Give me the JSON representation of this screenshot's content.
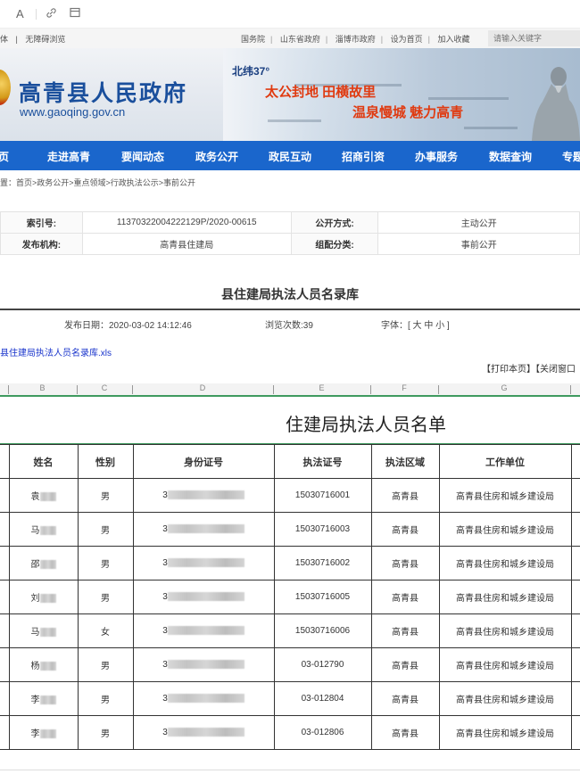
{
  "browser_toolbar": {
    "icons": [
      "font-icon",
      "link-icon",
      "window-icon"
    ],
    "font_glyph": "A"
  },
  "topbar": {
    "left_links": [
      "体",
      "|",
      "无障碍浏览"
    ],
    "right_links": [
      "国务院",
      "山东省政府",
      "淄博市政府",
      "设为首页",
      "加入收藏"
    ],
    "separator": "|",
    "search_placeholder": "请输入关键字"
  },
  "banner": {
    "site_name": "高青县人民政府",
    "site_url": "www.gaoqing.gov.cn",
    "latitude": "北纬37°",
    "slogan_line1": "太公封地  田横故里",
    "slogan_line2": "温泉慢城 魅力高青"
  },
  "nav": {
    "items": [
      "页",
      "走进高青",
      "要闻动态",
      "政务公开",
      "政民互动",
      "招商引资",
      "办事服务",
      "数据查询",
      "专题"
    ]
  },
  "breadcrumb": "置：首页>政务公开>重点领域>行政执法公示>事前公开",
  "meta": {
    "index_label": "索引号:",
    "index_value": "11370322004222129P/2020-00615",
    "disclosure_label": "公开方式:",
    "disclosure_value": "主动公开",
    "publisher_label": "发布机构:",
    "publisher_value": "高青县住建局",
    "category_label": "组配分类:",
    "category_value": "事前公开"
  },
  "article": {
    "title": "县住建局执法人员名录库",
    "publish_date": "发布日期：2020-03-02 14:12:46",
    "views": "浏览次数:39",
    "font_size": "字体：[ 大 中 小 ]",
    "attachment": "县住建局执法人员名录库.xls",
    "print": "【打印本页】",
    "close": "【关闭窗口"
  },
  "sheet": {
    "column_letters": [
      "B",
      "C",
      "D",
      "E",
      "F",
      "G"
    ],
    "title": "住建局执法人员名单",
    "headers": [
      "姓名",
      "性别",
      "身份证号",
      "执法证号",
      "执法区域",
      "工作单位"
    ],
    "rows": [
      {
        "name": "袁",
        "gender": "男",
        "id": "3",
        "cert": "15030716001",
        "area": "高青县",
        "unit": "高青县住房和城乡建设局"
      },
      {
        "name": "马",
        "gender": "男",
        "id": "3",
        "cert": "15030716003",
        "area": "高青县",
        "unit": "高青县住房和城乡建设局"
      },
      {
        "name": "邵",
        "gender": "男",
        "id": "3",
        "cert": "15030716002",
        "area": "高青县",
        "unit": "高青县住房和城乡建设局"
      },
      {
        "name": "刘",
        "gender": "男",
        "id": "3",
        "cert": "15030716005",
        "area": "高青县",
        "unit": "高青县住房和城乡建设局"
      },
      {
        "name": "马",
        "gender": "女",
        "id": "3",
        "cert": "15030716006",
        "area": "高青县",
        "unit": "高青县住房和城乡建设局"
      },
      {
        "name": "杨",
        "gender": "男",
        "id": "3",
        "cert": "03-012790",
        "area": "高青县",
        "unit": "高青县住房和城乡建设局"
      },
      {
        "name": "李",
        "gender": "男",
        "id": "3",
        "cert": "03-012804",
        "area": "高青县",
        "unit": "高青县住房和城乡建设局"
      },
      {
        "name": "李",
        "gender": "男",
        "id": "3",
        "cert": "03-012806",
        "area": "高青县",
        "unit": "高青县住房和城乡建设局"
      }
    ]
  },
  "colors": {
    "nav_blue": "#1a66cc",
    "site_blue": "#1a4f9c",
    "slogan_red": "#e03a10",
    "link_blue": "#1a35cc",
    "sheet_green": "#3f9a5f"
  }
}
